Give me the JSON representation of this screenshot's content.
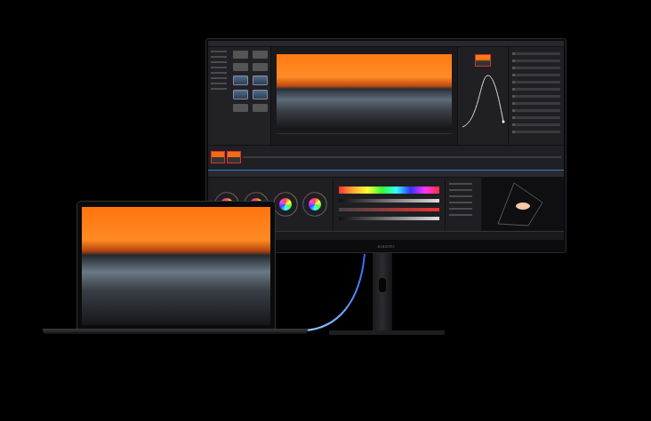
{
  "monitor": {
    "brand": "xiaomi"
  }
}
